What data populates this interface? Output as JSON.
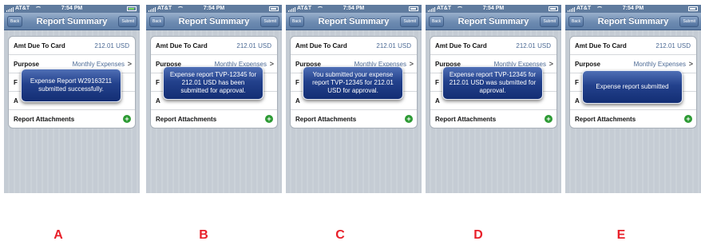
{
  "screens": [
    {
      "label": "A",
      "status": {
        "carrier": "AT&T",
        "time": "7:54 PM"
      },
      "nav": {
        "back": "Back",
        "title": "Report Summary",
        "submit": "Submit"
      },
      "rows": {
        "amt_label": "Amt Due To Card",
        "amt_value": "212.01 USD",
        "purpose_label": "Purpose",
        "purpose_value": "Monthly Expenses",
        "row3_label": "F",
        "row4_label": "A",
        "attachments_label": "Report Attachments"
      },
      "alert": "Expense Report W29163211 submitted successfully."
    },
    {
      "label": "B",
      "status": {
        "carrier": "AT&T",
        "time": "7:54 PM"
      },
      "nav": {
        "back": "Back",
        "title": "Report Summary",
        "submit": "Submit"
      },
      "rows": {
        "amt_label": "Amt Due To Card",
        "amt_value": "212.01 USD",
        "purpose_label": "Purpose",
        "purpose_value": "Monthly Expenses",
        "row3_label": "F",
        "row4_label": "A",
        "attachments_label": "Report Attachments"
      },
      "alert": "Expense report TVP-12345 for 212.01 USD has been submitted for approval."
    },
    {
      "label": "C",
      "status": {
        "carrier": "AT&T",
        "time": "7:54 PM"
      },
      "nav": {
        "back": "Back",
        "title": "Report Summary",
        "submit": "Submit"
      },
      "rows": {
        "amt_label": "Amt Due To Card",
        "amt_value": "212.01 USD",
        "purpose_label": "Purpose",
        "purpose_value": "Monthly Expenses",
        "row3_label": "F",
        "row4_label": "A",
        "attachments_label": "Report Attachments"
      },
      "alert": "You submitted your expense report TVP-12345 for 212.01 USD for approval."
    },
    {
      "label": "D",
      "status": {
        "carrier": "AT&T",
        "time": "7:54 PM"
      },
      "nav": {
        "back": "Back",
        "title": "Report Summary",
        "submit": "Submit"
      },
      "rows": {
        "amt_label": "Amt Due To Card",
        "amt_value": "212.01 USD",
        "purpose_label": "Purpose",
        "purpose_value": "Monthly Expenses",
        "row3_label": "F",
        "row4_label": "A",
        "attachments_label": "Report Attachments"
      },
      "alert": "Expense report TVP-12345 for 212.01 USD was submitted for approval."
    },
    {
      "label": "E",
      "status": {
        "carrier": "AT&T",
        "time": "7:54 PM"
      },
      "nav": {
        "back": "Back",
        "title": "Report Summary",
        "submit": "Submit"
      },
      "rows": {
        "amt_label": "Amt Due To Card",
        "amt_value": "212.01 USD",
        "purpose_label": "Purpose",
        "purpose_value": "Monthly Expenses",
        "row3_label": "F",
        "row4_label": "A",
        "attachments_label": "Report Attachments"
      },
      "alert": "Expense report submitted"
    }
  ],
  "colors": {
    "label_red": "#e8202a",
    "nav_blue": "#6d8bb1",
    "alert_blue": "#23418c",
    "value_blue": "#4c6a95",
    "add_green": "#2c9a33"
  },
  "icons": [
    "signal-icon",
    "wifi-icon",
    "battery-icon",
    "chevron-right-icon",
    "add-icon"
  ]
}
